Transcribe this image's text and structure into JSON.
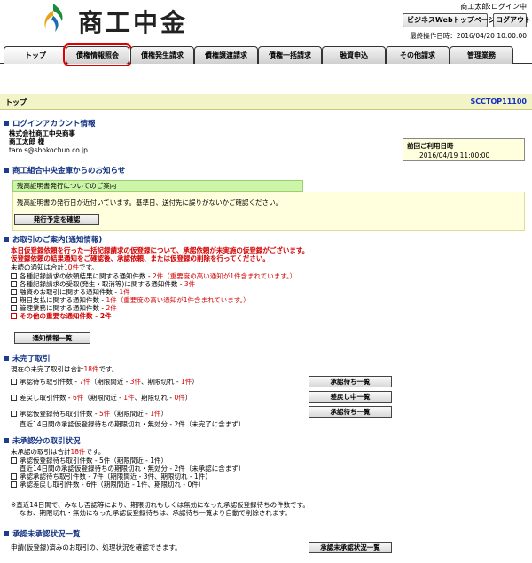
{
  "header": {
    "logo_text": "商工中金",
    "user_name": "商工太郎:ログイン中",
    "biz_top_button": "ビジネスWebトップページへ",
    "logout_button": "ログアウト",
    "last_operation": "最終操作日時：2016/04/20 10:00:00"
  },
  "tabs": [
    "トップ",
    "債権情報照会",
    "債権発生請求",
    "債権譲渡請求",
    "債権一括請求",
    "融資申込",
    "その他請求",
    "管理業務"
  ],
  "page": {
    "title": "トップ",
    "screen_id": "SCCTOP11100"
  },
  "login_account": {
    "heading": "ログインアカウント情報",
    "company": "株式会社商工中央商事",
    "person": "商工太郎 様",
    "email": "taro.s@shokochuo.co.jp",
    "last_login_label": "前回ご利用日時",
    "last_login_value": "2016/04/19 11:00:00"
  },
  "bank_notice": {
    "heading": "商工組合中央金庫からのお知らせ",
    "title": "残高証明書発行についてのご案内",
    "body": "残高証明書の発行日が近付いています。基準日、送付先に誤りがないかご確認ください。",
    "button": "発行予定を確認"
  },
  "notifications": {
    "heading": "お取引のご案内(通知情報)",
    "alert_line1": "本日仮登録依頼を行った一括記録請求の仮登録について、承認依頼が未実施の仮登録がございます。",
    "alert_line2": "仮登録依頼の結果通知をご確認後、承認依頼、または仮登録の削除を行ってください。",
    "unread_prefix": "未読の通知は合計",
    "unread_count": "10件",
    "unread_suffix": "です。",
    "items": [
      {
        "label": "各種記録請求の依頼結果に関する通知件数 ‐ ",
        "count": "2件",
        "note": "（重要度の高い通知が1件含まれています。）"
      },
      {
        "label": "各種記録請求の受取(発生・取消等)に関する通知件数 ‐ ",
        "count": "3件",
        "note": ""
      },
      {
        "label": "融資のお取引に関する通知件数 ‐ ",
        "count": "1件",
        "note": ""
      },
      {
        "label": "期日支払に関する通知件数 ‐ ",
        "count": "1件",
        "note": "（重要度の高い通知が1件含まれています。）"
      },
      {
        "label": "管理業務に関する通知件数 ‐ ",
        "count": "2件",
        "note": ""
      }
    ],
    "important_item": "その他の重要な通知件数 ‐ 2件",
    "button": "通知情報一覧"
  },
  "incomplete": {
    "heading": "未完了取引",
    "summary_prefix": "現在の未完了取引は合計",
    "summary_count": "18件",
    "summary_suffix": "です。",
    "rows": [
      {
        "label": "承認待ち取引件数 ‐ ",
        "count": "7件",
        "detail_a": "（期限間近 ‐ ",
        "a": "3件",
        "detail_b": "、期限切れ ‐ ",
        "b": "1件",
        "detail_c": "）",
        "button": "承認待ち一覧"
      },
      {
        "label": "差戻し取引件数 ‐ ",
        "count": "6件",
        "detail_a": "（期限間近 ‐ ",
        "a": "1件",
        "detail_b": "、期限切れ ‐ ",
        "b": "0件",
        "detail_c": "）",
        "button": "差戻し中一覧"
      },
      {
        "label": "承認仮登録待ち取引件数 ‐ ",
        "count": "5件",
        "detail_a": "（期限間近 ‐ ",
        "a": "1件",
        "detail_b": "",
        "b": "",
        "detail_c": "）",
        "button": "承認待ち一覧"
      }
    ],
    "sub_line": "直近14日間の承認仮登録待ちの期限切れ・無効分 ‐ 2件（未完了に含まず）"
  },
  "unapproved": {
    "heading": "未承認分の取引状況",
    "summary_prefix": "未承認の取引は合計",
    "summary_count": "18件",
    "summary_suffix": "です。",
    "rows": [
      "承認仮登録待ち取引件数 ‐ 5件（期限間近 ‐ 1件）",
      "直近14日間の承認仮登録待ちの期限切れ・無効分 ‐ 2件（未承認に含まず）",
      "承認承認待ち取引件数 ‐ 7件（期限間近 ‐ 3件、期限切れ ‐ 1件）",
      "承認差戻し取引件数 ‐ 6件（期限間近 ‐ 1件、期限切れ ‐ 0件）"
    ],
    "note_line1": "※直近14日間で、みなし否認等により、期限切れもしくは無効になった承認仮登録待ちの件数です。",
    "note_line2": "なお、期限切れ・無効になった承認仮登録待ちは、承認待ち一覧より自動で削除されます。"
  },
  "registration_status": {
    "heading": "承認未承認状況一覧",
    "body": "申請(仮登録)済みのお取引の、処理状況を確認できます。",
    "button": "承認未承認状況一覧"
  }
}
